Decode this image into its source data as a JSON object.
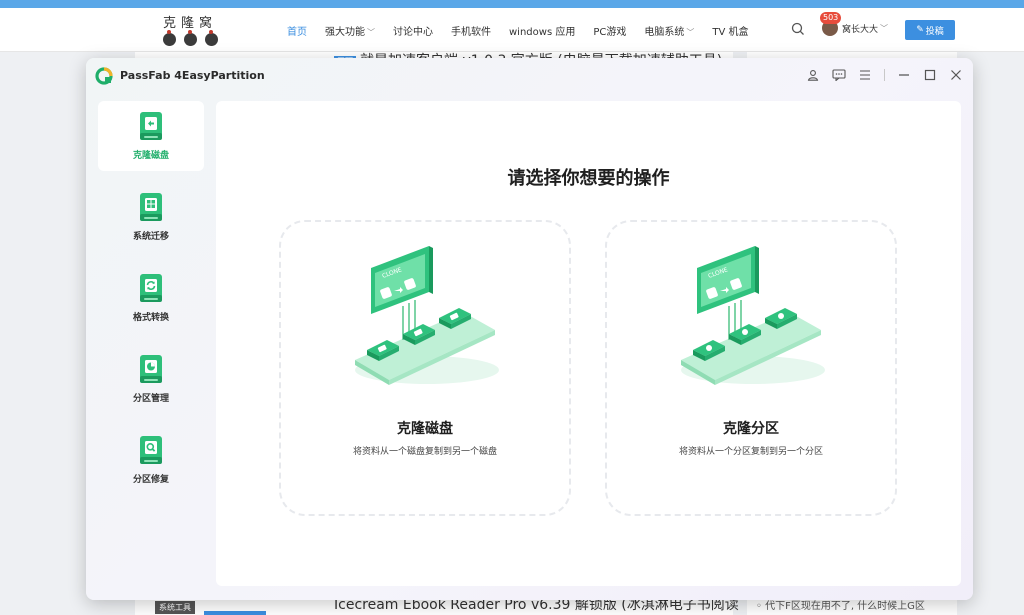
{
  "site": {
    "logo_text": "克隆窝",
    "menu": [
      {
        "label": "首页",
        "active": true,
        "dropdown": false
      },
      {
        "label": "强大功能",
        "active": false,
        "dropdown": true
      },
      {
        "label": "讨论中心",
        "active": false,
        "dropdown": false
      },
      {
        "label": "手机软件",
        "active": false,
        "dropdown": false
      },
      {
        "label": "windows 应用",
        "active": false,
        "dropdown": false
      },
      {
        "label": "PC游戏",
        "active": false,
        "dropdown": false
      },
      {
        "label": "电脑系统",
        "active": false,
        "dropdown": true
      },
      {
        "label": "TV 机盒",
        "active": false,
        "dropdown": false
      }
    ],
    "user": {
      "badge": "503",
      "name": "窝长大大"
    },
    "post_button": "投稿",
    "article_top": {
      "tag": "置顶",
      "title": "就是加速客户端 v1.0.3 官方版 (电脑最下载加速辅助工具)"
    },
    "article_bottom": "Icecream Ebook Reader Pro v6.39 解锁版 (冰淇淋电子书阅读",
    "bottom_tag": "系统工具",
    "side_bottom": "代下F区现在用不了, 什么时候上G区",
    "accent_color": "#3c8fe0"
  },
  "app": {
    "title": "PassFab 4EasyPartition",
    "title_actions": [
      "user-icon",
      "feedback-icon",
      "menu-icon",
      "minimize-icon",
      "maximize-icon",
      "close-icon"
    ],
    "sidebar": [
      {
        "label": "克隆磁盘",
        "icon": "clone-disk-icon",
        "active": true
      },
      {
        "label": "系统迁移",
        "icon": "system-migration-icon",
        "active": false
      },
      {
        "label": "格式转换",
        "icon": "format-convert-icon",
        "active": false
      },
      {
        "label": "分区管理",
        "icon": "partition-manage-icon",
        "active": false
      },
      {
        "label": "分区修复",
        "icon": "partition-repair-icon",
        "active": false
      }
    ],
    "main_title": "请选择你想要的操作",
    "cards": [
      {
        "title": "克隆磁盘",
        "desc": "将资料从一个磁盘复制到另一个磁盘",
        "illustration_text": "CLONE"
      },
      {
        "title": "克隆分区",
        "desc": "将资料从一个分区复制到另一个分区",
        "illustration_text": "CLONE"
      }
    ],
    "accent_color": "#1fae6a"
  }
}
